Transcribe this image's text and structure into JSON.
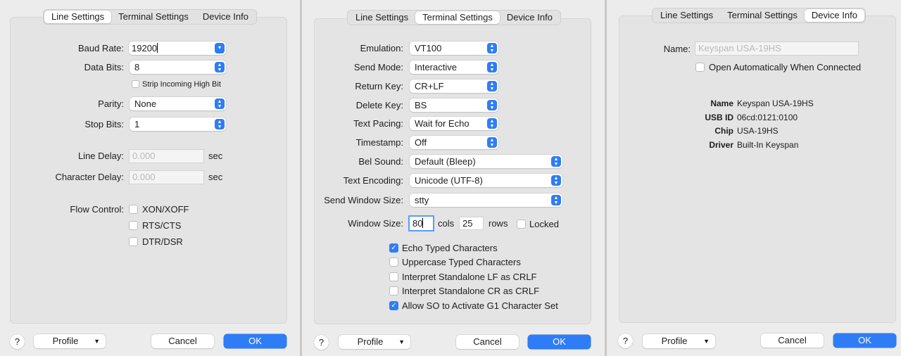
{
  "tabs": [
    "Line Settings",
    "Terminal Settings",
    "Device Info"
  ],
  "line_settings": {
    "baud_rate": {
      "label": "Baud Rate:",
      "value": "19200"
    },
    "data_bits": {
      "label": "Data Bits:",
      "value": "8"
    },
    "strip_high_bit": {
      "label": "Strip Incoming High Bit",
      "checked": false
    },
    "parity": {
      "label": "Parity:",
      "value": "None"
    },
    "stop_bits": {
      "label": "Stop Bits:",
      "value": "1"
    },
    "line_delay": {
      "label": "Line Delay:",
      "placeholder": "0.000",
      "unit": "sec"
    },
    "char_delay": {
      "label": "Character Delay:",
      "placeholder": "0.000",
      "unit": "sec"
    },
    "flow_control": {
      "label": "Flow Control:",
      "options": [
        {
          "label": "XON/XOFF",
          "checked": false
        },
        {
          "label": "RTS/CTS",
          "checked": false
        },
        {
          "label": "DTR/DSR",
          "checked": false
        }
      ]
    }
  },
  "terminal_settings": {
    "emulation": {
      "label": "Emulation:",
      "value": "VT100"
    },
    "send_mode": {
      "label": "Send Mode:",
      "value": "Interactive"
    },
    "return_key": {
      "label": "Return Key:",
      "value": "CR+LF"
    },
    "delete_key": {
      "label": "Delete Key:",
      "value": "BS"
    },
    "text_pacing": {
      "label": "Text Pacing:",
      "value": "Wait for Echo"
    },
    "timestamp": {
      "label": "Timestamp:",
      "value": "Off"
    },
    "bel_sound": {
      "label": "Bel Sound:",
      "value": "Default (Bleep)"
    },
    "text_encoding": {
      "label": "Text Encoding:",
      "value": "Unicode (UTF-8)"
    },
    "send_window_size": {
      "label": "Send Window Size:",
      "value": "stty"
    },
    "window_size": {
      "label": "Window Size:",
      "cols": "80",
      "cols_label": "cols",
      "rows": "25",
      "rows_label": "rows",
      "locked_label": "Locked"
    },
    "checkboxes": [
      {
        "label": "Echo Typed Characters",
        "checked": true
      },
      {
        "label": "Uppercase Typed Characters",
        "checked": false
      },
      {
        "label": "Interpret Standalone LF as CRLF",
        "checked": false
      },
      {
        "label": "Interpret Standalone CR as CRLF",
        "checked": false
      },
      {
        "label": "Allow SO to Activate G1 Character Set",
        "checked": true
      }
    ]
  },
  "device_info": {
    "name_label": "Name:",
    "name_placeholder": "Keyspan USA-19HS",
    "open_auto": {
      "label": "Open Automatically When Connected",
      "checked": false
    },
    "details": [
      {
        "key": "Name",
        "value": "Keyspan USA-19HS"
      },
      {
        "key": "USB ID",
        "value": "06cd:0121:0100"
      },
      {
        "key": "Chip",
        "value": "USA-19HS"
      },
      {
        "key": "Driver",
        "value": "Built-In Keyspan"
      }
    ]
  },
  "footer": {
    "help": "?",
    "profile": "Profile",
    "cancel": "Cancel",
    "ok": "OK"
  },
  "colors": {
    "accent": "#2f7df6",
    "background": "#ececec"
  }
}
